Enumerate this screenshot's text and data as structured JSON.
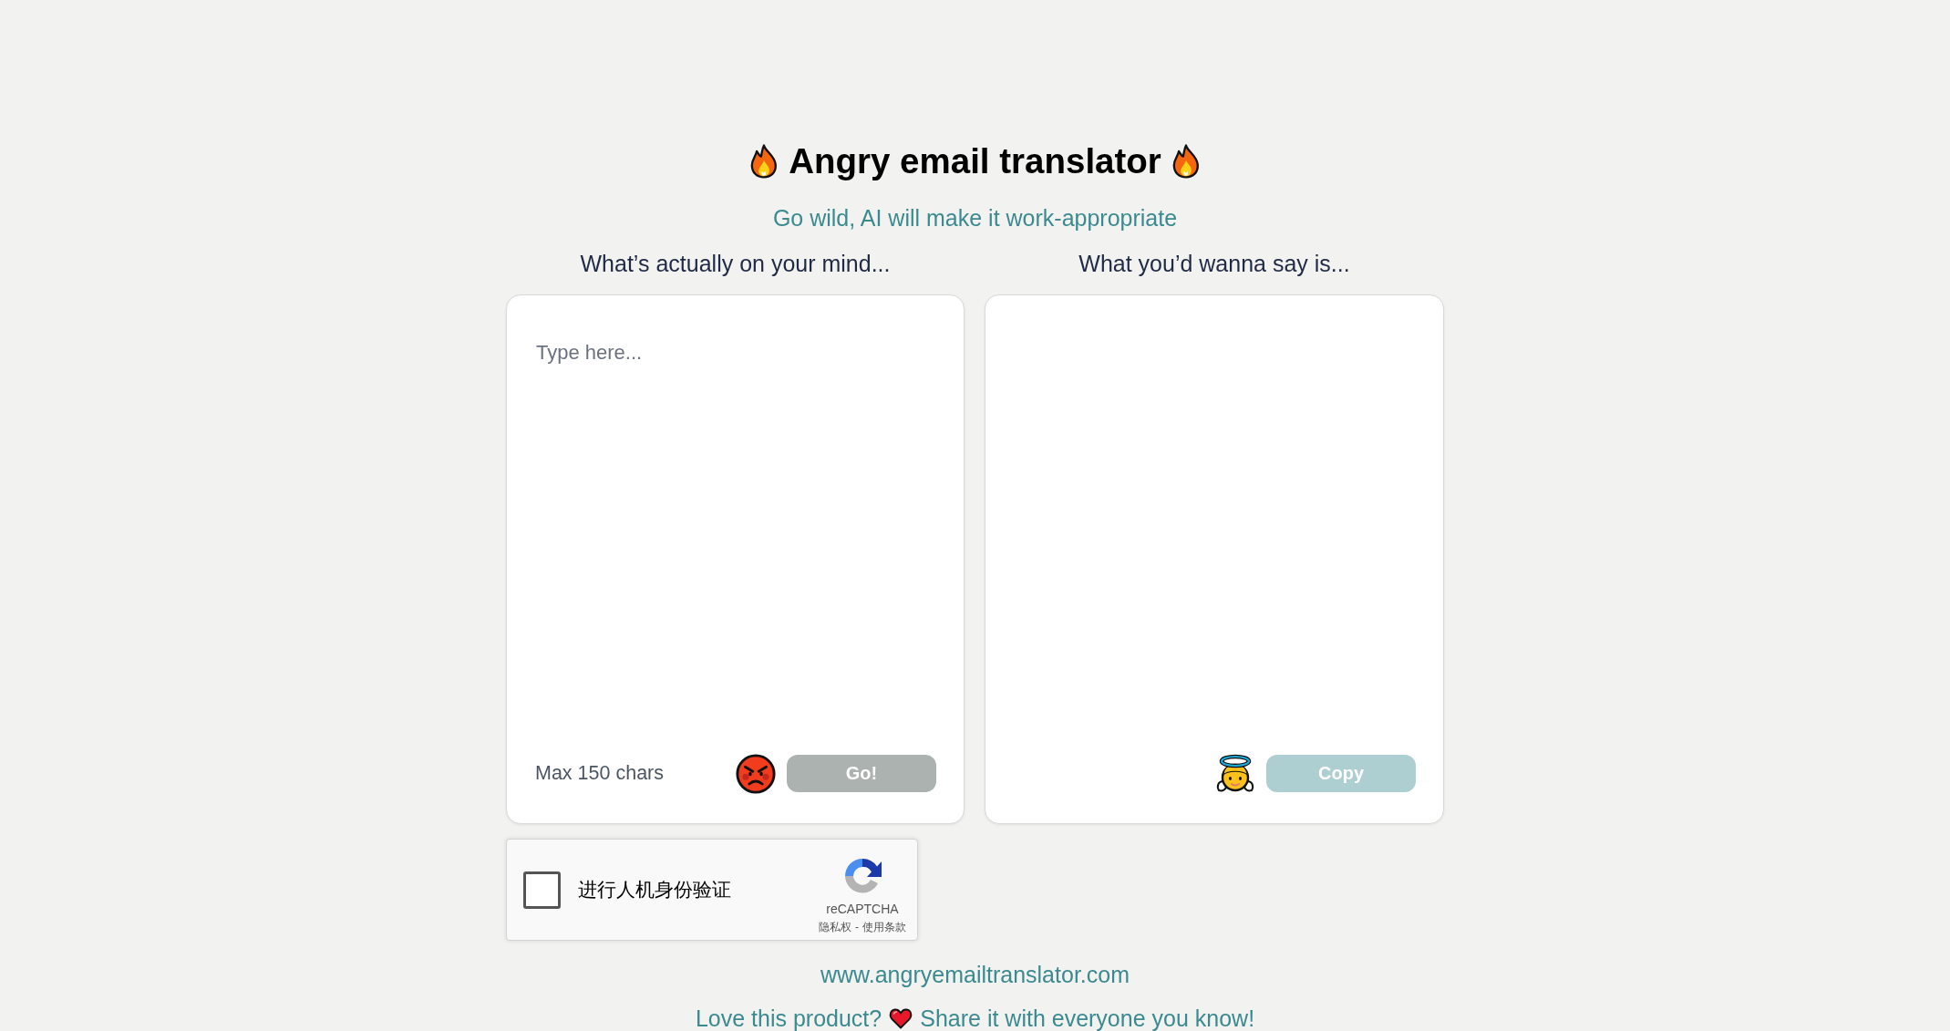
{
  "header": {
    "title": "Angry email translator",
    "subtitle": "Go wild, AI will make it work-appropriate"
  },
  "panels": [
    {
      "kind": "input",
      "label": "What’s actually on your mind...",
      "placeholder": "Type here...",
      "hint": "Max 150 chars",
      "button": {
        "label": "Go!",
        "disabled": true
      }
    },
    {
      "kind": "output",
      "label": "What you’d wanna say is...",
      "button": {
        "label": "Copy",
        "disabled": true
      }
    }
  ],
  "captcha": {
    "checked": false,
    "label": "进行人机身份验证",
    "brand": "reCAPTCHA",
    "privacy_link": "隐私权",
    "separator": "-",
    "terms_link": "使用条款"
  },
  "footer": {
    "url": "www.angryemailtranslator.com",
    "share_prompt": "Love this product?",
    "share_call": "Share it with everyone you know!"
  }
}
